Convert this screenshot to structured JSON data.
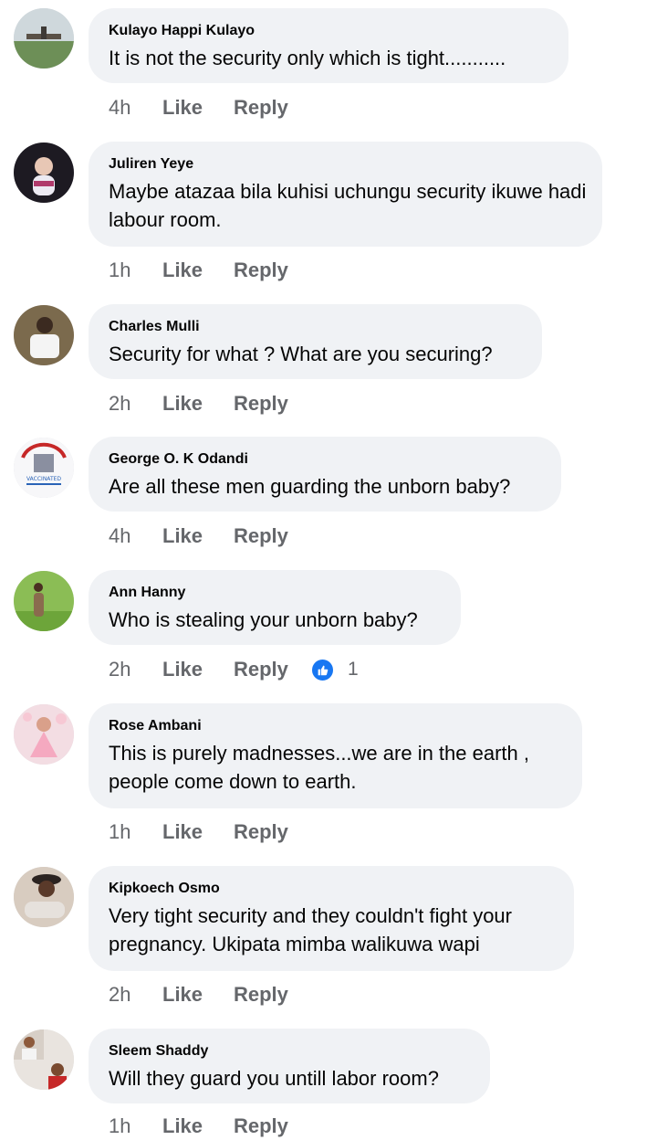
{
  "comments": [
    {
      "author": "Kulayo Happi Kulayo",
      "text": "It is not the security only which is tight...........",
      "time": "4h"
    },
    {
      "author": "Juliren Yeye",
      "text": "Maybe atazaa bila kuhisi uchungu security ikuwe hadi labour room.",
      "time": "1h"
    },
    {
      "author": "Charles Mulli",
      "text": "Security for what ? What are you securing?",
      "time": "2h"
    },
    {
      "author": "George O. K Odandi",
      "text": "Are all these men guarding the unborn baby?",
      "time": "4h",
      "avatar_text": "VACCINATED"
    },
    {
      "author": "Ann Hanny",
      "text": "Who is stealing your unborn baby?",
      "time": "2h",
      "reaction_count": "1",
      "reaction_icon": "thumbs-up-icon"
    },
    {
      "author": "Rose Ambani",
      "text": "This is purely madnesses...we are in the earth , people come down to earth.",
      "time": "1h"
    },
    {
      "author": "Kipkoech Osmo",
      "text": "Very tight security and they couldn't fight your pregnancy. Ukipata mimba walikuwa wapi",
      "time": "2h"
    },
    {
      "author": "Sleem Shaddy",
      "text": "Will they guard you untill labor room?",
      "time": "1h"
    }
  ],
  "labels": {
    "like": "Like",
    "reply": "Reply"
  },
  "colors": {
    "bubble": "#f0f2f5",
    "meta": "#65676b",
    "text": "#050505",
    "reaction": "#1877f2"
  }
}
